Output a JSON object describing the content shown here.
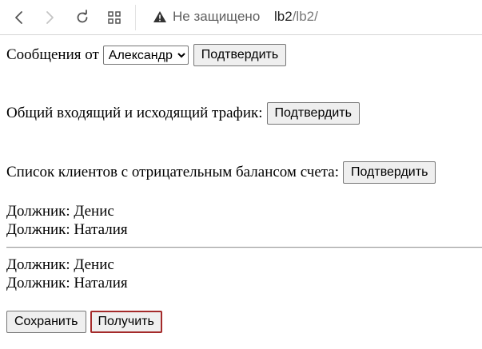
{
  "browser": {
    "security_text": "Не защищено",
    "url_host": "lb2",
    "url_path": "/lb2/"
  },
  "icons": {
    "back": "back-arrow-icon",
    "forward": "forward-arrow-icon",
    "reload": "reload-icon",
    "apps": "apps-grid-icon",
    "warning": "warning-triangle-icon"
  },
  "form1": {
    "label": "Сообщения от",
    "select_value": "Александр",
    "submit_label": "Подтвердить"
  },
  "form2": {
    "label": "Общий входящий и исходящий трафик:",
    "submit_label": "Подтвердить"
  },
  "form3": {
    "label": "Список клиентов с отрицательным балансом счета:",
    "submit_label": "Подтвердить"
  },
  "debtors_top": [
    "Должник: Денис",
    "Должник: Наталия"
  ],
  "debtors_bottom": [
    "Должник: Денис",
    "Должник: Наталия"
  ],
  "actions": {
    "save_label": "Сохранить",
    "get_label": "Получить"
  }
}
